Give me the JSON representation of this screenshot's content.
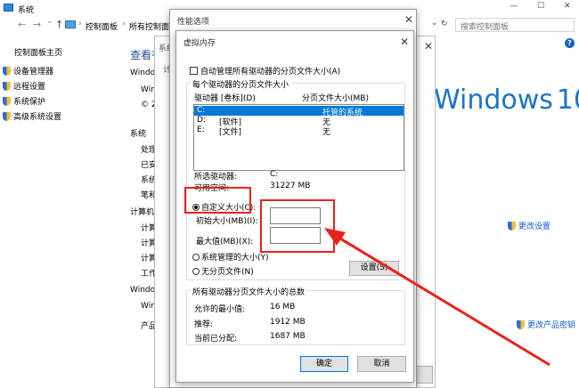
{
  "window": {
    "title": "系统"
  },
  "titlebar": {
    "minimize": "—",
    "maximize": "☐",
    "close": "✕"
  },
  "nav": {
    "back": "←",
    "forward": "→",
    "up": "↑",
    "crumb1": "控制面板",
    "crumb2": "所有控制面板",
    "sep": "›",
    "refresh": "↻",
    "dropdown": "⌄",
    "search_placeholder": "搜索控制面板",
    "help": "?"
  },
  "sidebar": {
    "home": "控制面板主页",
    "items": [
      "设备管理器",
      "远程设置",
      "系统保护",
      "高级系统设置"
    ]
  },
  "main": {
    "heading": "查看有",
    "win_label": "Windo",
    "line_win": "Win",
    "line_copy": "© 2",
    "section_system": "系统",
    "sys_rows": [
      "处理",
      "已安",
      "系统",
      "笔和"
    ],
    "section_computer": "计算机名",
    "comp_rows": [
      "计算",
      "计算",
      "计算",
      "工作"
    ],
    "section_activation": "Window",
    "act_rows": [
      "Win",
      "产品"
    ],
    "change_settings": "更改设置",
    "change_key": "更改产品密钥",
    "brand": "Windows",
    "brand_num": "10"
  },
  "bg_dialog": {
    "tab": "系统",
    "tab2": "计"
  },
  "perf": {
    "title": "性能选项",
    "close": "✕"
  },
  "vm": {
    "title": "虚拟内存",
    "close": "✕",
    "auto_manage": "自动管理所有驱动器的分页文件大小(A)",
    "group1": "每个驱动器的分页文件大小",
    "col_drive": "驱动器 [卷标](D)",
    "col_size": "分页文件大小(MB)",
    "drives": [
      {
        "drive": "C:",
        "label": "",
        "size": "托管的系统"
      },
      {
        "drive": "D:",
        "label": "[软件]",
        "size": "无"
      },
      {
        "drive": "E:",
        "label": "[文件]",
        "size": "无"
      }
    ],
    "selected_drive_label": "所选驱动器:",
    "selected_drive_value": "C:",
    "free_space_label": "可用空间:",
    "free_space_value": "31227 MB",
    "custom_size": "自定义大小(C):",
    "initial_size": "初始大小(MB)(I):",
    "max_size": "最大值(MB)(X):",
    "system_managed": "系统管理的大小(Y)",
    "no_paging": "无分页文件(N)",
    "set_button": "设置(S)",
    "group2": "所有驱动器分页文件大小的总数",
    "min_allowed_label": "允许的最小值:",
    "min_allowed_value": "16 MB",
    "recommended_label": "推荐:",
    "recommended_value": "1912 MB",
    "current_label": "当前已分配:",
    "current_value": "1687 MB",
    "ok": "确定",
    "cancel": "取消"
  },
  "colors": {
    "annotation": "#e8231d",
    "brand": "#1e73c8",
    "selection": "#0078d7"
  }
}
